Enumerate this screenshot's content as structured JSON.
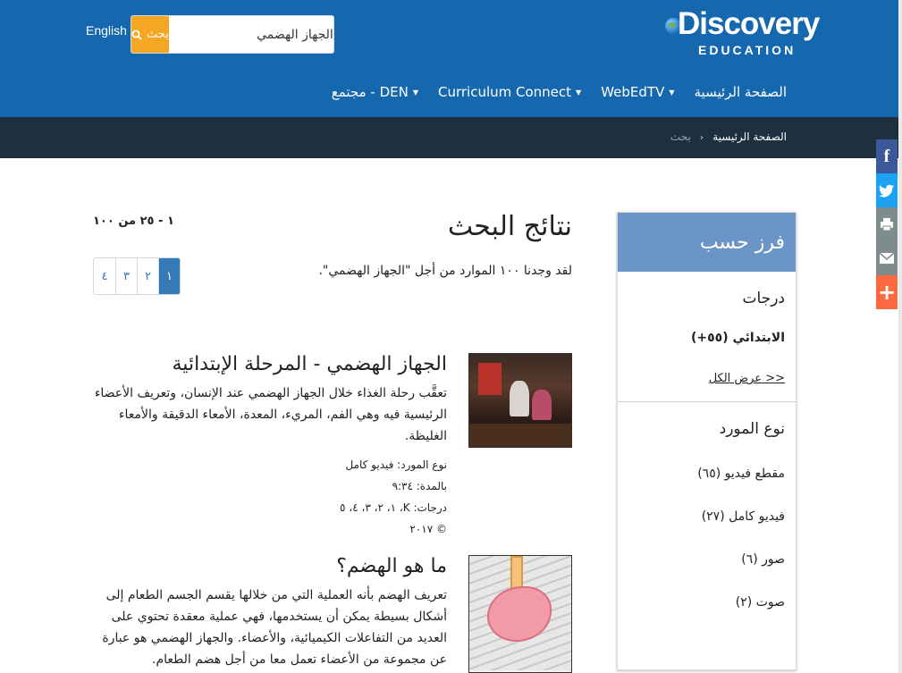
{
  "header": {
    "brand_name": "Discovery",
    "brand_sub": "EDUCATION",
    "language": "English",
    "search": {
      "value": "الجهاز الهضمي",
      "button_label": "بحث"
    },
    "nav": [
      {
        "label": "الصفحة الرئيسية",
        "dropdown": false
      },
      {
        "label": "WebEdTV",
        "dropdown": true
      },
      {
        "label": "Curriculum Connect",
        "dropdown": true
      },
      {
        "label": "مجتمع - DEN",
        "dropdown": true
      }
    ]
  },
  "breadcrumb": {
    "home": "الصفحة الرئيسية",
    "separator": "›",
    "current": "بحث"
  },
  "share": {
    "facebook": "f"
  },
  "sidebar": {
    "heading": "فرز حسب",
    "grades": {
      "title": "درجات",
      "selected": "الابتدائي (٥٥+)",
      "show_all": "عرض الكل >>"
    },
    "resource_type": {
      "title": "نوع المورد",
      "items": [
        "مقطع فيديو (٦٥)",
        "فيديو كامل (٢٧)",
        "صور (٦)",
        "صوت (٢)"
      ]
    }
  },
  "results": {
    "title": "نتائج البحث",
    "summary": "لقد وجدنا ١٠٠ الموارد من أجل \"الجهاز الهضمي\".",
    "range": "١ - ٢٥ من ١٠٠",
    "pages": [
      "١",
      "٢",
      "٣",
      "٤"
    ],
    "active_page": "١",
    "items": [
      {
        "title": "الجهاز الهضمي - المرحلة الإبتدائية",
        "description": "تعقَّب رحلة الغذاء خلال الجهاز الهضمي عند الإنسان، وتعريف الأعضاء الرئيسية فيه وهي الفم، المريء، المعدة، الأمعاء الدقيقة والأمعاء الغليظة.",
        "meta": [
          "نوع المورد: فيديو كامل",
          "بالمدة: ٩:٣٤",
          "درجات: K، ١، ٢، ٣، ٤، ٥",
          "© ٢٠١٧"
        ]
      },
      {
        "title": "ما هو الهضم؟",
        "description": "تعريف الهضم بأنه العملية التي من خلالها يقسم الجسم الطعام إلى أشكال بسيطة يمكن أن يستخدمها، فهي عملية معقدة تحتوي على العديد من التفاعلات الكيميائية، والأعضاء. والجهاز الهضمي هو عبارة عن مجموعة من الأعضاء تعمل معا من أجل هضم الطعام."
      }
    ]
  }
}
